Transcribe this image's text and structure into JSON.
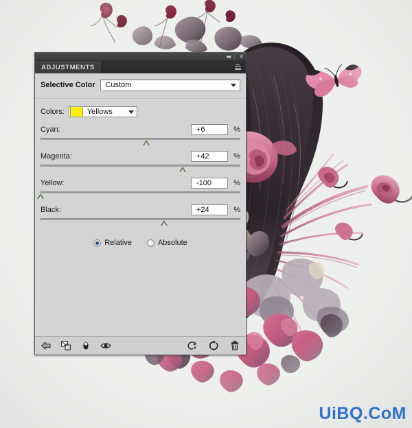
{
  "artwork": {
    "description": "Digital collage: woman with dark flowing hair, pink roses, hydrangea blooms and a butterfly on light gray background",
    "background_color": "#eef0ed",
    "accent_pink": "#d9738f",
    "deep_rose": "#8f2744",
    "hair_dark": "#2e2730",
    "leaf_mauve": "#8e7a86"
  },
  "panel": {
    "topbar": {
      "collapse_label": "◂◂",
      "separator": "|",
      "close_label": "✕"
    },
    "tabs": [
      {
        "label": "ADJUSTMENTS",
        "active": true
      }
    ],
    "menu_icon": "panel-menu-icon",
    "header": {
      "title": "Selective Color",
      "preset_value": "Custom",
      "preset_caret": "chevron-down-icon"
    },
    "colors": {
      "label": "Colors:",
      "swatch_color": "#fff200",
      "value": "Yellows",
      "caret": "chevron-down-icon"
    },
    "sliders": [
      {
        "name": "Cyan:",
        "value": "+6",
        "unit": "%",
        "percent": 53
      },
      {
        "name": "Magenta:",
        "value": "+42",
        "unit": "%",
        "percent": 71
      },
      {
        "name": "Yellow:",
        "value": "-100",
        "unit": "%",
        "percent": 0
      },
      {
        "name": "Black:",
        "value": "+24",
        "unit": "%",
        "percent": 62
      }
    ],
    "method": {
      "options": [
        {
          "label": "Relative",
          "selected": true
        },
        {
          "label": "Absolute",
          "selected": false
        }
      ]
    },
    "footer": {
      "icons": [
        {
          "name": "previous-state-arrow-icon",
          "title": "Return to adjustment list"
        },
        {
          "name": "clip-to-layer-icon",
          "title": "Clip to layer"
        },
        {
          "name": "toggle-layer-visibility-icon",
          "title": "Toggle layer visibility"
        },
        {
          "name": "preview-eye-icon",
          "title": "Preview"
        },
        {
          "name": "reset-to-previous-icon",
          "title": "View previous state"
        },
        {
          "name": "reset-adjustment-icon",
          "title": "Reset adjustment"
        },
        {
          "name": "delete-layer-icon",
          "title": "Delete adjustment layer"
        }
      ]
    }
  },
  "watermark": {
    "text": "UiBQ.CoM",
    "color": "#2f6fd0"
  }
}
